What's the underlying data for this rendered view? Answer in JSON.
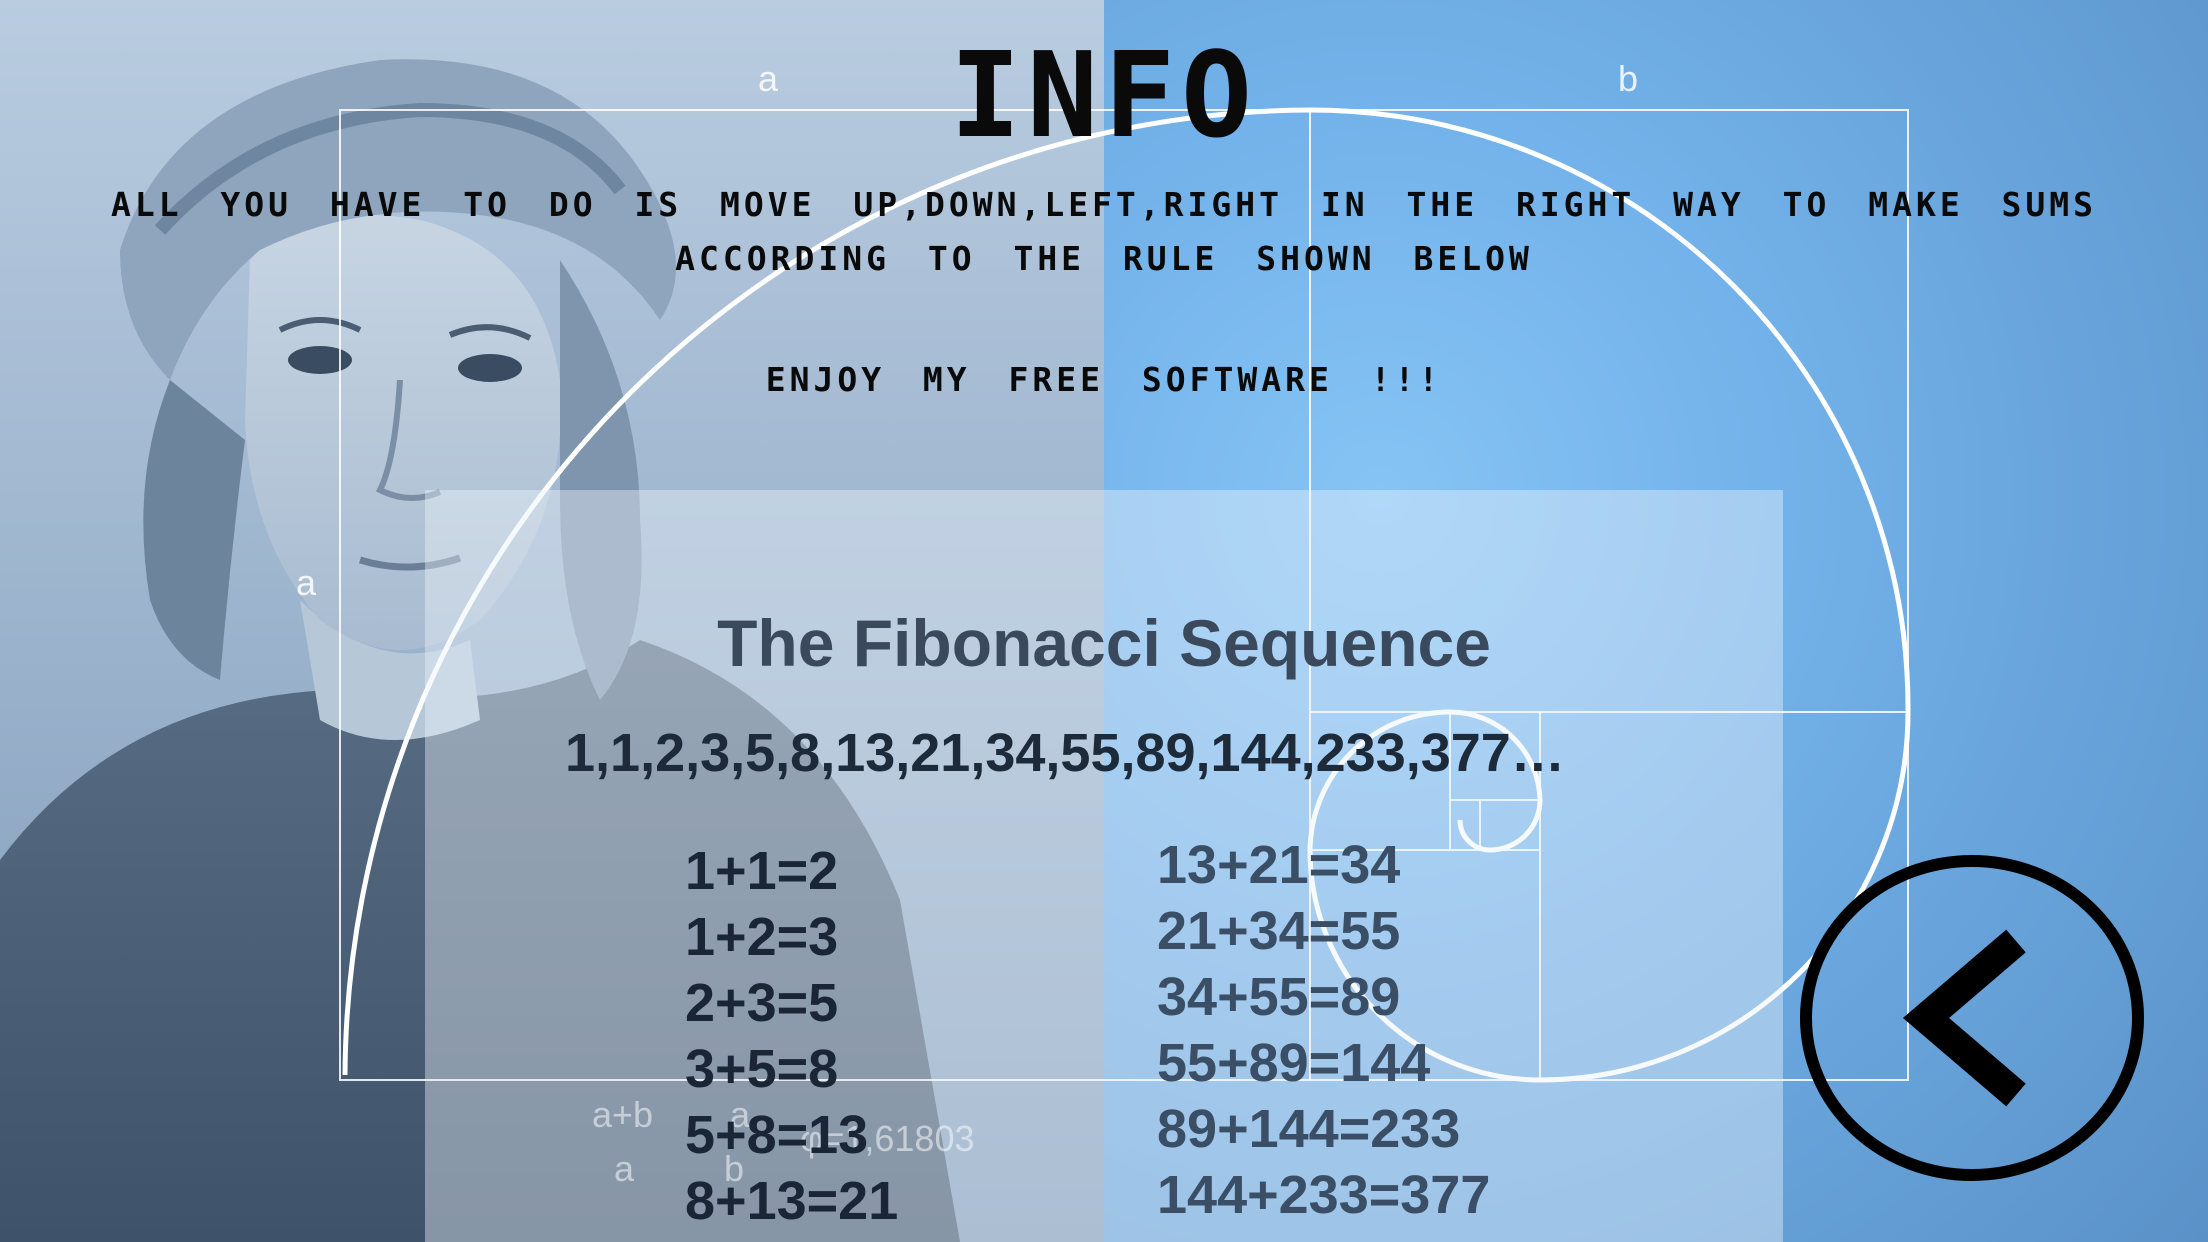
{
  "header": {
    "title": "INFO"
  },
  "instructions": {
    "line": "All you have to do is move up,down,left,right in the right way to make sums according to the rule shown below",
    "enjoy": "enjoy my free software !!!"
  },
  "background": {
    "labels": {
      "a_top": "a",
      "b_top": "b",
      "a_side": "a",
      "ratio_num": "a+b",
      "ratio_a": "a",
      "ratio_b": "b",
      "ratio_a_right": "a",
      "phi_value": "φ=1,61803"
    }
  },
  "card": {
    "title": "The Fibonacci Sequence",
    "sequence": "1,1,2,3,5,8,13,21,34,55,89,144,233,377…",
    "sums_left": [
      "1+1=2",
      "1+2=3",
      "2+3=5",
      "3+5=8",
      "5+8=13",
      "8+13=21"
    ],
    "sums_right": [
      "13+21=34",
      "21+34=55",
      "34+55=89",
      "55+89=144",
      "89+144=233",
      "144+233=377"
    ]
  },
  "controls": {
    "back_icon": "chevron-left-circle-icon"
  },
  "colors": {
    "text_dark": "#0a0a0a",
    "panel_left": "#9fb6cf",
    "panel_right": "#73b2ea",
    "card_title": "#3a4a5c"
  }
}
